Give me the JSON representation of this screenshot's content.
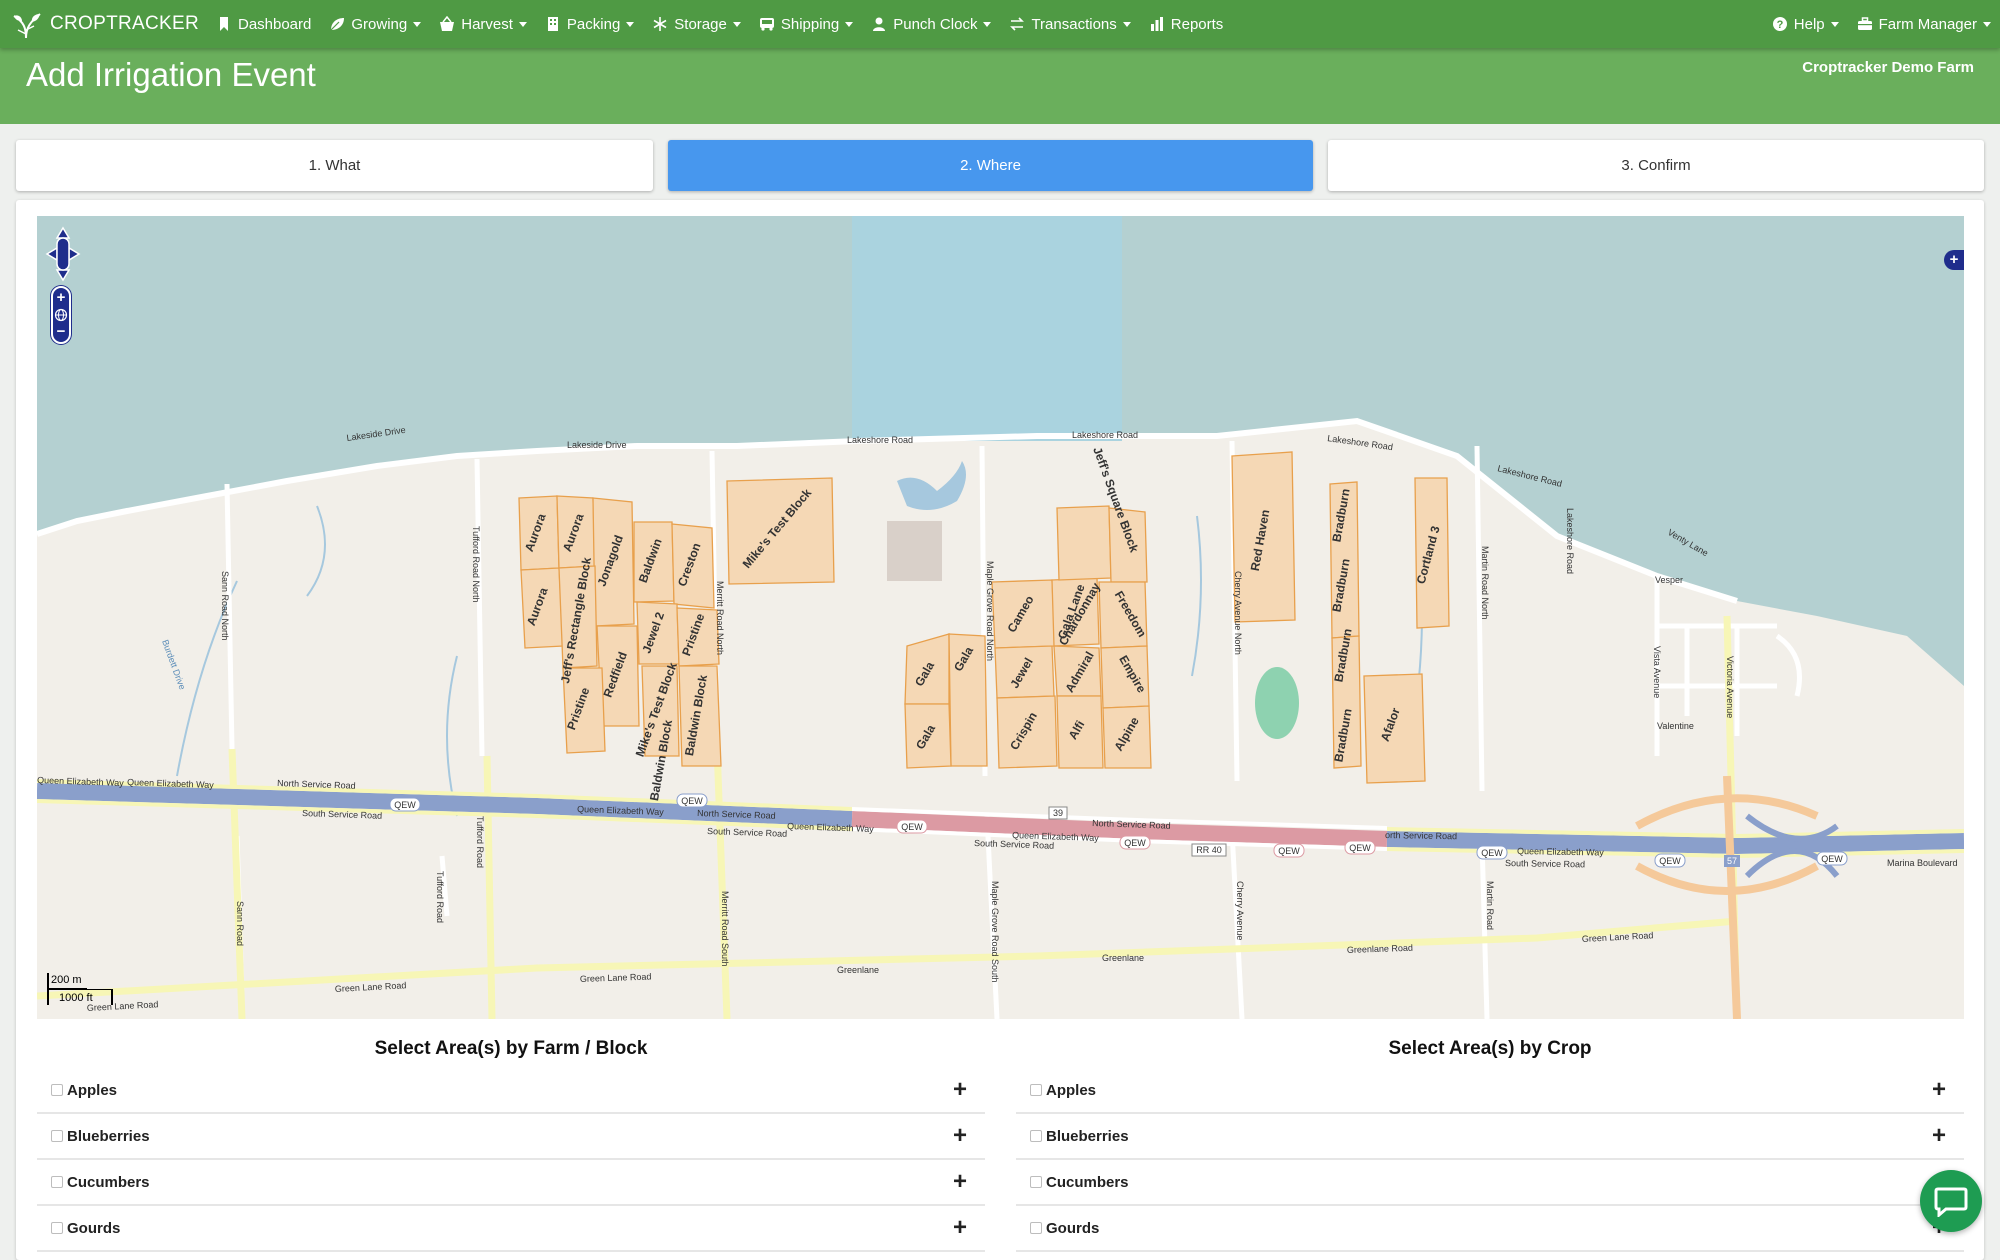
{
  "nav": {
    "brand": "CROPTRACKER",
    "items": [
      {
        "label": "Dashboard",
        "icon": "bookmark-icon",
        "dropdown": false
      },
      {
        "label": "Growing",
        "icon": "leaf-icon",
        "dropdown": true
      },
      {
        "label": "Harvest",
        "icon": "basket-icon",
        "dropdown": true
      },
      {
        "label": "Packing",
        "icon": "building-icon",
        "dropdown": true
      },
      {
        "label": "Storage",
        "icon": "snowflake-icon",
        "dropdown": true
      },
      {
        "label": "Shipping",
        "icon": "bus-icon",
        "dropdown": true
      },
      {
        "label": "Punch Clock",
        "icon": "user-icon",
        "dropdown": true
      },
      {
        "label": "Transactions",
        "icon": "exchange-icon",
        "dropdown": true
      },
      {
        "label": "Reports",
        "icon": "bar-chart-icon",
        "dropdown": false
      }
    ],
    "right": [
      {
        "label": "Help",
        "icon": "question-circle-icon"
      },
      {
        "label": "Farm Manager",
        "icon": "briefcase-icon"
      }
    ]
  },
  "header": {
    "title": "Add Irrigation Event",
    "farm": "Croptracker Demo Farm"
  },
  "steps": [
    "1. What",
    "2. Where",
    "3. Confirm"
  ],
  "active_step": 1,
  "map": {
    "scale_metric": "200 m",
    "scale_imperial": "1000 ft",
    "roads": [
      "Lakeside Drive",
      "Lakeside Drive",
      "Lakeshore Road",
      "Lakeshore Road",
      "Lakeshore Road",
      "Lakeshore Road",
      "Queen Elizabeth Way",
      "Queen Elizabeth Way",
      "Queen Elizabeth Way",
      "Queen Elizabeth Way",
      "Queen Elizabeth Way",
      "Queen Elizabeth Way",
      "North Service Road",
      "South Service Road",
      "North Service Road",
      "South Service Road",
      "North Service Road",
      "South Service Road",
      "orth Service Road",
      "South Service Road",
      "Green Lane Road",
      "Green Lane Road",
      "Green Lane Road",
      "Green Lane Road",
      "Greenlane",
      "Greenlane",
      "Greenlane Road",
      "Sann Road North",
      "Tufford Road North",
      "Tufford Road",
      "Tufford Road",
      "Merritt Road North",
      "Merritt Road South",
      "Maple Grove Road North",
      "Maple Grove Road South",
      "Cherry Avenue North",
      "Cherry Avenue",
      "Martin Road North",
      "Martin Road",
      "Victoria Avenue",
      "Vista Avenue",
      "Valentine",
      "Vesper",
      "Venty Lane",
      "Lakeshore Road",
      "Marina Boulevard",
      "Sann Road",
      "Burdett Drive"
    ],
    "shields": [
      "QEW",
      "QEW",
      "QEW",
      "QEW",
      "QEW",
      "QEW",
      "QEW",
      "QEW",
      "QEW",
      "39",
      "RR 40",
      "57"
    ],
    "blocks": [
      "Aurora",
      "Aurora",
      "Aurora",
      "Jonagold",
      "Baldwin",
      "Creston",
      "Jeff's Rectangle Block",
      "Redfield",
      "Jewel 2",
      "Mike's Test Block",
      "Pristine",
      "Pristine",
      "Mike's Test Block",
      "Baldwin Block",
      "Baldwin Block",
      "Gala",
      "Gala",
      "Gala",
      "Cameo",
      "Jewel",
      "Crispin",
      "Gala Lane",
      "Chardonnay",
      "Admiral",
      "Alfi",
      "Jeff's Square Block",
      "Freedom",
      "Empire",
      "Alpine",
      "Red Haven",
      "Bradburn",
      "Bradburn",
      "Bradburn",
      "Bradburn",
      "Afalor",
      "Cortland 3"
    ]
  },
  "farm_block": {
    "heading": "Select Area(s) by Farm / Block",
    "items": [
      "Apples",
      "Blueberries",
      "Cucumbers",
      "Gourds"
    ]
  },
  "crop": {
    "heading": "Select Area(s) by Crop",
    "items": [
      "Apples",
      "Blueberries",
      "Cucumbers",
      "Gourds"
    ]
  },
  "colors": {
    "nav": "#4f9a44",
    "header": "#6aaf5c",
    "active_step": "#4797ee",
    "water": "#b4d0d1",
    "land": "#f2efe9",
    "block_fill": "#f5d8b5",
    "block_stroke": "#e8a04c",
    "highway": "#8a9fcb",
    "highway_red": "#dc9aa3",
    "road_yellow": "#f7f6b6",
    "chat": "#1e9c52"
  }
}
